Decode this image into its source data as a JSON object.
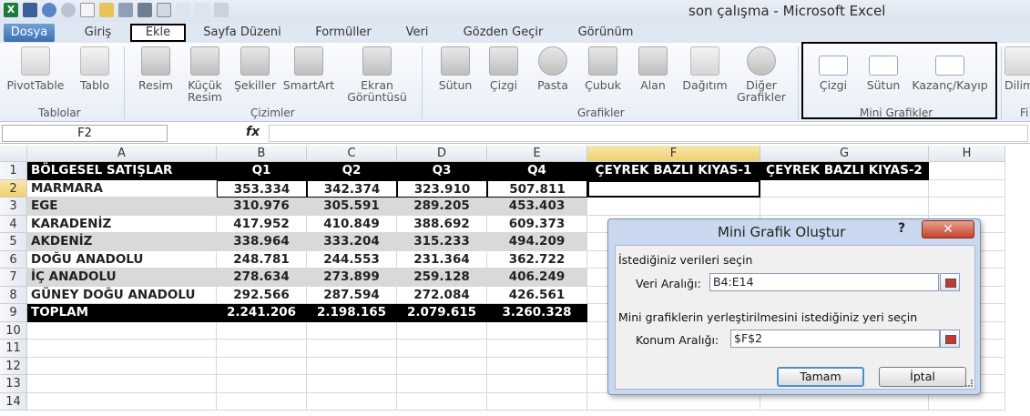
{
  "title": "son çalışma  -  Microsoft Excel",
  "tabs": [
    "Dosya",
    "Giriş",
    "Ekle",
    "Sayfa Düzeni",
    "Formüller",
    "Veri",
    "Gözden Geçir",
    "Görünüm"
  ],
  "ribbon": {
    "pivot_table": "PivotTable",
    "table": "Tablo",
    "picture": "Resim",
    "clip_art_1": "Küçük",
    "clip_art_2": "Resim",
    "shapes": "Şekiller",
    "smartart": "SmartArt",
    "screenshot_1": "Ekran",
    "screenshot_2": "Görüntüsü",
    "column": "Sütun",
    "line": "Çizgi",
    "pie": "Pasta",
    "bar": "Çubuk",
    "area": "Alan",
    "scatter": "Dağıtım",
    "other_charts_1": "Diğer",
    "other_charts_2": "Grafikler",
    "spark_line": "Çizgi",
    "spark_column": "Sütun",
    "spark_winloss": "Kazanç/Kayıp",
    "cut_off": "Dilim",
    "groups": {
      "tables": "Tablolar",
      "illustrations": "Çizimler",
      "charts": "Grafikler",
      "sparklines": "Mini Grafikler",
      "cut_off": "Fi"
    }
  },
  "formula_bar": {
    "name_box": "F2",
    "fx": "fx",
    "value": ""
  },
  "columns": [
    "A",
    "B",
    "C",
    "D",
    "E",
    "F",
    "G",
    "H"
  ],
  "rows": [
    "1",
    "2",
    "3",
    "4",
    "5",
    "6",
    "7",
    "8",
    "9",
    "10",
    "11",
    "12",
    "13",
    "14"
  ],
  "sheet": {
    "header": [
      "BÖLGESEL SATIŞLAR",
      "Q1",
      "Q2",
      "Q3",
      "Q4",
      "ÇEYREK BAZLI KIYAS-1",
      "ÇEYREK BAZLI KIYAS-2"
    ],
    "data": [
      [
        "MARMARA",
        "353.334",
        "342.374",
        "323.910",
        "507.811"
      ],
      [
        "EGE",
        "310.976",
        "305.591",
        "289.205",
        "453.403"
      ],
      [
        "KARADENİZ",
        "417.952",
        "410.849",
        "388.692",
        "609.373"
      ],
      [
        "AKDENİZ",
        "338.964",
        "333.204",
        "315.233",
        "494.209"
      ],
      [
        "DOĞU ANADOLU",
        "248.781",
        "244.553",
        "231.364",
        "362.722"
      ],
      [
        "İÇ ANADOLU",
        "278.634",
        "273.899",
        "259.128",
        "406.249"
      ],
      [
        "GÜNEY DOĞU ANADOLU",
        "292.566",
        "287.594",
        "272.084",
        "426.561"
      ]
    ],
    "total": [
      "TOPLAM",
      "2.241.206",
      "2.198.165",
      "2.079.615",
      "3.260.328"
    ]
  },
  "dialog": {
    "title": "Mini Grafik Oluştur",
    "help": "?",
    "close": "✕",
    "section1": "İstediğiniz verileri seçin",
    "data_range_label": "Veri Aralığı:",
    "data_range_value": "B4:E14",
    "section2": "Mini grafiklerin yerleştirilmesini istediğiniz yeri seçin",
    "location_label": "Konum Aralığı:",
    "location_value": "$F$2",
    "ok": "Tamam",
    "cancel": "İptal"
  }
}
